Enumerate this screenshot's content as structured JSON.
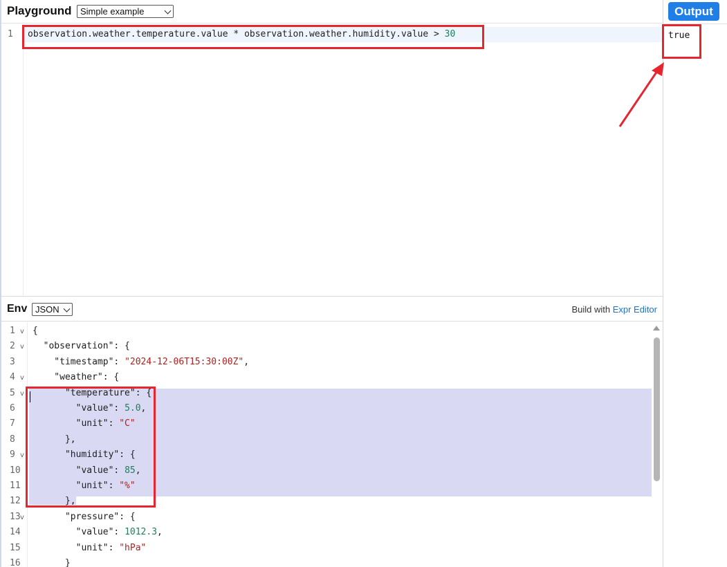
{
  "header": {
    "title": "Playground",
    "example_select": "Simple example"
  },
  "expression_editor": {
    "line_number": "1",
    "parts": {
      "expr": "observation.weather.temperature.value * observation.weather.humidity.value > ",
      "number": "30"
    }
  },
  "env_bar": {
    "title": "Env",
    "format_select": "JSON",
    "credit_prefix": "Build with ",
    "credit_link": "Expr Editor"
  },
  "env_editor": {
    "line_numbers": [
      "1",
      "2",
      "3",
      "4",
      "5",
      "6",
      "7",
      "8",
      "9",
      "10",
      "11",
      "12",
      "13",
      "14",
      "15",
      "16"
    ],
    "lines": [
      {
        "t": "{"
      },
      {
        "t": "  \"observation\": {"
      },
      {
        "k": "    \"timestamp\": ",
        "s": "\"2024-12-06T15:30:00Z\"",
        "e": ","
      },
      {
        "t": "    \"weather\": {"
      },
      {
        "t": "      \"temperature\": {"
      },
      {
        "k": "        \"value\": ",
        "n": "5.0",
        "e": ","
      },
      {
        "k": "        \"unit\": ",
        "s": "\"C\"",
        "e": ""
      },
      {
        "t": "      },"
      },
      {
        "t": "      \"humidity\": {"
      },
      {
        "k": "        \"value\": ",
        "n": "85",
        "e": ","
      },
      {
        "k": "        \"unit\": ",
        "s": "\"%\"",
        "e": ""
      },
      {
        "t": "      },"
      },
      {
        "t": "      \"pressure\": {"
      },
      {
        "k": "        \"value\": ",
        "n": "1012.3",
        "e": ","
      },
      {
        "k": "        \"unit\": ",
        "s": "\"hPa\"",
        "e": ""
      },
      {
        "t": "      }"
      }
    ],
    "fold_glyph": "v"
  },
  "output": {
    "button_label": "Output",
    "result": "true"
  },
  "colors": {
    "accent": "#1f7fe6",
    "annotation": "#e5262e",
    "selection": "#d9d9f3"
  }
}
